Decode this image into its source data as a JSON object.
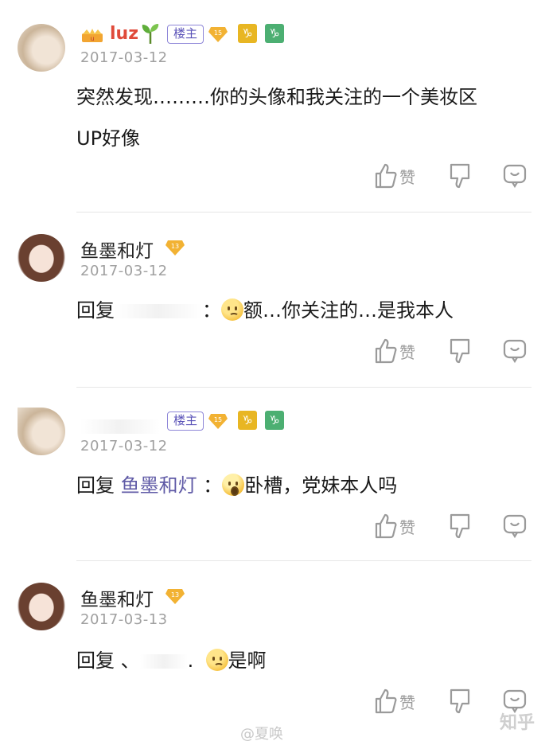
{
  "comments": [
    {
      "user": "luz",
      "is_owner": true,
      "level": "15",
      "date": "2017-03-12",
      "text": "突然发现………你的头像和我关注的一个美妆区UP好像",
      "text_line1": "突然发现………你的头像和我关注的一个美妆区",
      "text_line2": "UP好像",
      "like_label": "赞",
      "owner_badge": "楼主"
    },
    {
      "user": "鱼墨和灯",
      "level": "13",
      "date": "2017-03-12",
      "reply_prefix": "回复",
      "reply_colon": "：",
      "text": "额…你关注的…是我本人",
      "like_label": "赞"
    },
    {
      "is_owner": true,
      "level": "15",
      "date": "2017-03-12",
      "reply_prefix": "回复",
      "reply_to": "鱼墨和灯",
      "reply_colon": "：",
      "text": "卧槽，党妹本人吗",
      "like_label": "赞",
      "owner_badge": "楼主"
    },
    {
      "user": "鱼墨和灯",
      "level": "13",
      "date": "2017-03-13",
      "reply_prefix": "回复",
      "reply_mark": "、",
      "reply_dot": ".",
      "text": "是啊",
      "like_label": "赞"
    }
  ],
  "watermark": "@夏唤",
  "brand": "知乎",
  "colors": {
    "owner_badge": "#8e86d8",
    "mention": "#5f5aa6",
    "date": "#a0a0a0",
    "vip_name": "#e04a3a",
    "level_badge": "#f2b233",
    "zodiac_yellow": "#e8b623",
    "zodiac_green": "#4caf72"
  },
  "icons": [
    "crown-icon",
    "sprout-icon",
    "level-diamond-icon",
    "zodiac-icon",
    "thumb-up-icon",
    "thumb-down-icon",
    "reply-bubble-icon"
  ]
}
